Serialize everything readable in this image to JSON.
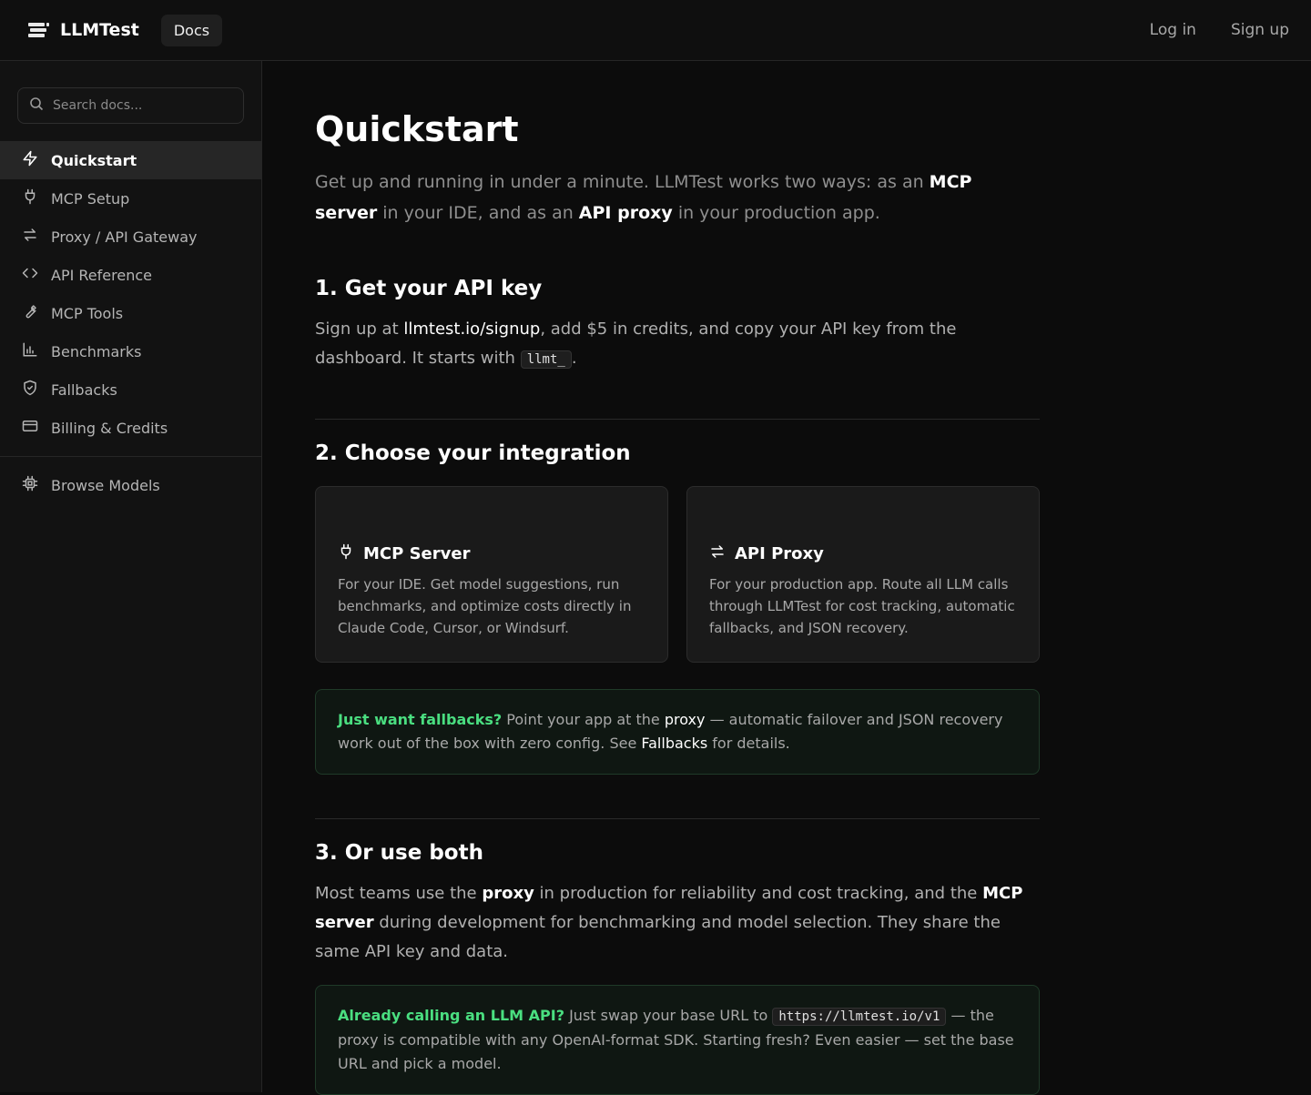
{
  "header": {
    "brand": "LLMTest",
    "docs_label": "Docs",
    "login": "Log in",
    "signup": "Sign up"
  },
  "sidebar": {
    "search_placeholder": "Search docs...",
    "items": [
      {
        "label": "Quickstart",
        "icon": "bolt-icon",
        "active": true
      },
      {
        "label": "MCP Setup",
        "icon": "plug-icon"
      },
      {
        "label": "Proxy / API Gateway",
        "icon": "arrows-swap-icon"
      },
      {
        "label": "API Reference",
        "icon": "code-icon"
      },
      {
        "label": "MCP Tools",
        "icon": "wrench-icon"
      },
      {
        "label": "Benchmarks",
        "icon": "bar-chart-icon"
      },
      {
        "label": "Fallbacks",
        "icon": "shield-icon"
      },
      {
        "label": "Billing & Credits",
        "icon": "credit-card-icon"
      }
    ],
    "browse_models": "Browse Models"
  },
  "main": {
    "title": "Quickstart",
    "lead": {
      "t1": "Get up and running in under a minute. LLMTest works two ways: as an ",
      "b1": "MCP server",
      "t2": " in your IDE, and as an ",
      "b2": "API proxy",
      "t3": " in your production app."
    },
    "step1": {
      "title": "1. Get your API key",
      "t1": "Sign up at ",
      "link": "llmtest.io/signup",
      "t2": ", add $5 in credits, and copy your API key from the dashboard. It starts with ",
      "code": "llmt_",
      "t3": "."
    },
    "step2": {
      "title": "2. Choose your integration",
      "cards": [
        {
          "title": "MCP Server",
          "desc": "For your IDE. Get model suggestions, run benchmarks, and optimize costs directly in Claude Code, Cursor, or Windsurf."
        },
        {
          "title": "API Proxy",
          "desc": "For your production app. Route all LLM calls through LLMTest for cost tracking, automatic fallbacks, and JSON recovery."
        }
      ],
      "callout": {
        "hl": "Just want fallbacks?",
        "t1": " Point your app at the ",
        "b1": "proxy",
        "t2": " — automatic failover and JSON recovery work out of the box with zero config. See ",
        "link": "Fallbacks",
        "t3": " for details."
      }
    },
    "step3": {
      "title": "3. Or use both",
      "t1": "Most teams use the ",
      "b1": "proxy",
      "t2": " in production for reliability and cost tracking, and the ",
      "b2": "MCP server",
      "t3": " during development for benchmarking and model selection. They share the same API key and data.",
      "callout": {
        "hl": "Already calling an LLM API?",
        "t1": " Just swap your base URL to ",
        "code": "https://llmtest.io/v1",
        "t2": " — the proxy is compatible with any OpenAI-format SDK. Starting fresh? Even easier — set the base URL and pick a model."
      }
    }
  }
}
